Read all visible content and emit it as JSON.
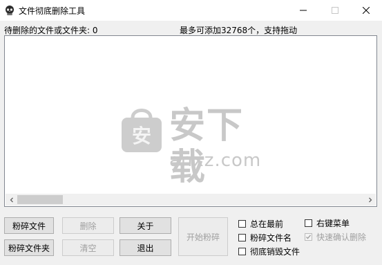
{
  "window": {
    "title": "文件彻底删除工具",
    "icon": "skull-icon"
  },
  "status": {
    "pending_label": "待删除的文件或文件夹: 0",
    "hint": "最多可添加32768个，支持拖动"
  },
  "watermark": {
    "cn_text": "安下载",
    "en_text": "anxz.com",
    "bag_char": "安"
  },
  "buttons": {
    "shred_file": "粉碎文件",
    "shred_folder": "粉碎文件夹",
    "delete": "删除",
    "clear": "清空",
    "about": "关于",
    "exit": "退出",
    "start": "开始粉碎"
  },
  "options": {
    "always_on_top": {
      "label": "总在最前",
      "checked": false,
      "enabled": true
    },
    "shred_filename": {
      "label": "粉碎文件名",
      "checked": false,
      "enabled": true
    },
    "secure_destroy": {
      "label": "彻底销毁文件",
      "checked": false,
      "enabled": true
    },
    "context_menu": {
      "label": "右键菜单",
      "checked": false,
      "enabled": true
    },
    "quick_confirm": {
      "label": "快速确认删除",
      "checked": true,
      "enabled": false
    }
  },
  "colors": {
    "title_bg": "#ffffff",
    "window_bg": "#f0f0f0",
    "watermark": "#c8c8c8"
  }
}
